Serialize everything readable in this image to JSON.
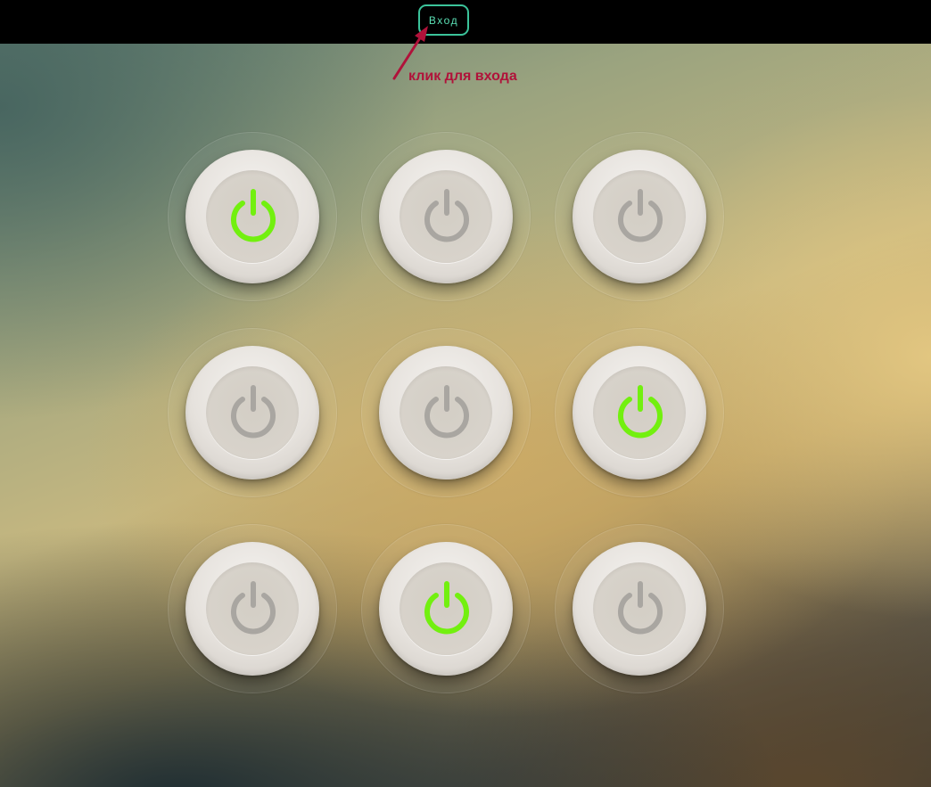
{
  "header": {
    "login_label": "Вход"
  },
  "annotation": {
    "text": "клик для входа",
    "color": "#b0123a"
  },
  "colors": {
    "active": "#72f00f",
    "inactive": "#a9a6a1",
    "login_border": "#3bc39a",
    "login_text": "#5be0b5"
  },
  "power_grid": {
    "rows": 3,
    "columns": 3,
    "buttons": [
      {
        "row": 1,
        "column": 1,
        "icon": "power-icon",
        "active": true
      },
      {
        "row": 1,
        "column": 2,
        "icon": "power-icon",
        "active": false
      },
      {
        "row": 1,
        "column": 3,
        "icon": "power-icon",
        "active": false
      },
      {
        "row": 2,
        "column": 1,
        "icon": "power-icon",
        "active": false
      },
      {
        "row": 2,
        "column": 2,
        "icon": "power-icon",
        "active": false
      },
      {
        "row": 2,
        "column": 3,
        "icon": "power-icon",
        "active": true
      },
      {
        "row": 3,
        "column": 1,
        "icon": "power-icon",
        "active": false
      },
      {
        "row": 3,
        "column": 2,
        "icon": "power-icon",
        "active": true
      },
      {
        "row": 3,
        "column": 3,
        "icon": "power-icon",
        "active": false
      }
    ]
  }
}
